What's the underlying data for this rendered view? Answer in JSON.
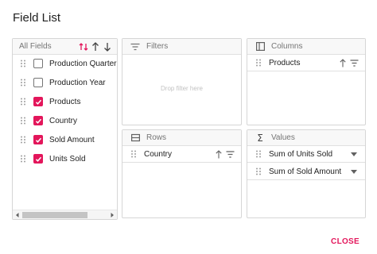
{
  "dialog": {
    "title": "Field List",
    "close_label": "CLOSE"
  },
  "colors": {
    "accent": "#e3165b",
    "border": "#d6d6d6",
    "header_bg": "#f8f8f8",
    "muted_text": "#757575"
  },
  "all_fields": {
    "title": "All Fields",
    "fields": [
      {
        "label": "Production Quarter Ye",
        "checked": false
      },
      {
        "label": "Production Year",
        "checked": false
      },
      {
        "label": "Products",
        "checked": true
      },
      {
        "label": "Country",
        "checked": true
      },
      {
        "label": "Sold Amount",
        "checked": true
      },
      {
        "label": "Units Sold",
        "checked": true
      }
    ]
  },
  "filters": {
    "title": "Filters",
    "drop_hint": "Drop filter here",
    "icon": "filter-lines-icon"
  },
  "columns": {
    "title": "Columns",
    "icon": "columns-icon",
    "items": [
      {
        "label": "Products"
      }
    ]
  },
  "rows": {
    "title": "Rows",
    "icon": "rows-icon",
    "items": [
      {
        "label": "Country"
      }
    ]
  },
  "values": {
    "title": "Values",
    "icon": "sigma-icon",
    "items": [
      {
        "label": "Sum of Units Sold"
      },
      {
        "label": "Sum of Sold Amount"
      }
    ]
  }
}
